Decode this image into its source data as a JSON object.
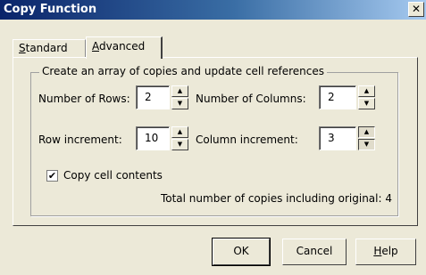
{
  "window": {
    "title": "Copy Function",
    "close_glyph": "✕"
  },
  "tabs": [
    {
      "label": "Standard",
      "mnemonic": "S",
      "rest": "tandard",
      "active": false
    },
    {
      "label": "Advanced",
      "mnemonic": "A",
      "rest": "dvanced",
      "active": true
    }
  ],
  "group": {
    "title": "Create an array of copies and update cell references"
  },
  "fields": {
    "rows": {
      "label": "Number of Rows:",
      "value": "2"
    },
    "columns": {
      "label": "Number of Columns:",
      "value": "2"
    },
    "row_increment": {
      "label": "Row increment:",
      "value": "10"
    },
    "column_increment": {
      "label": "Column increment:",
      "value": "3"
    }
  },
  "copy_contents": {
    "label": "Copy cell contents",
    "checked": true,
    "check_glyph": "✔"
  },
  "summary": "Total number of copies including original: 4",
  "buttons": {
    "ok": "OK",
    "cancel": "Cancel",
    "help_mnemonic": "H",
    "help_rest": "elp"
  },
  "icons": {
    "up": "▲",
    "down": "▼"
  }
}
